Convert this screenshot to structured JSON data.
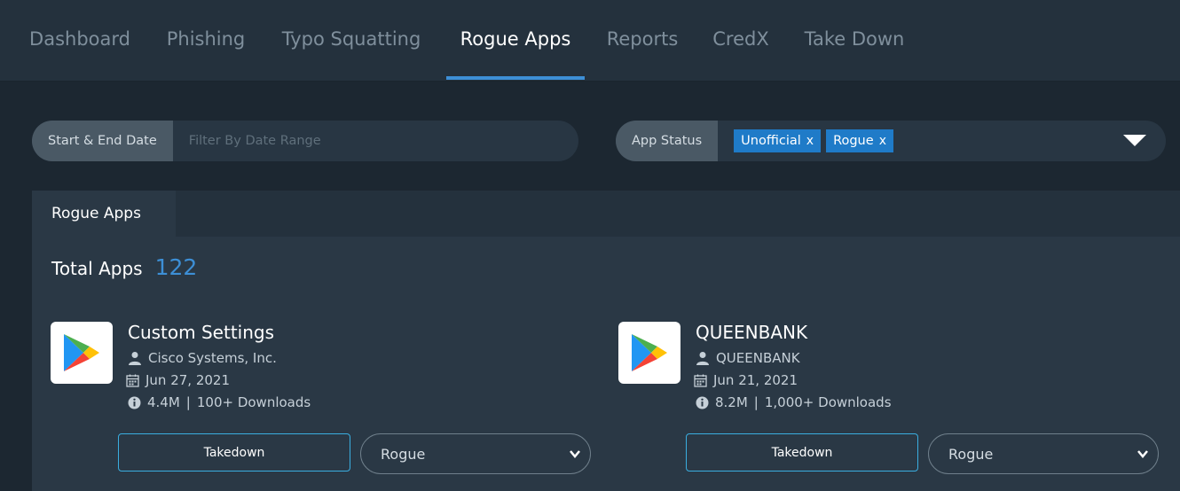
{
  "nav": {
    "tabs": [
      {
        "label": "Dashboard"
      },
      {
        "label": "Phishing"
      },
      {
        "label": "Typo Squatting"
      },
      {
        "label": "Rogue Apps"
      },
      {
        "label": "Reports"
      },
      {
        "label": "CredX"
      },
      {
        "label": "Take Down"
      }
    ],
    "active": "Rogue Apps"
  },
  "filters": {
    "date": {
      "label": "Start & End Date",
      "placeholder": "Filter By Date Range"
    },
    "status": {
      "label": "App Status",
      "chips": [
        "Unofficial",
        "Rogue"
      ],
      "chip_remove": "x"
    }
  },
  "panel": {
    "tab": "Rogue Apps",
    "total_label": "Total Apps",
    "total_count": "122"
  },
  "apps": [
    {
      "name": "Custom Settings",
      "developer": "Cisco Systems, Inc.",
      "date": "Jun 27, 2021",
      "size": "4.4M",
      "separator": "|",
      "downloads": "100+ Downloads",
      "takedown_label": "Takedown",
      "status": "Rogue",
      "icon": "google-play-icon"
    },
    {
      "name": "QUEENBANK",
      "developer": "QUEENBANK",
      "date": "Jun 21, 2021",
      "size": "8.2M",
      "separator": "|",
      "downloads": "1,000+ Downloads",
      "takedown_label": "Takedown",
      "status": "Rogue",
      "icon": "google-play-icon"
    }
  ],
  "colors": {
    "background": "#1c2731",
    "nav_bg": "#24313d",
    "accent": "#3d8fd6",
    "chip": "#1f7bc8",
    "button_border": "#3aaee0"
  }
}
